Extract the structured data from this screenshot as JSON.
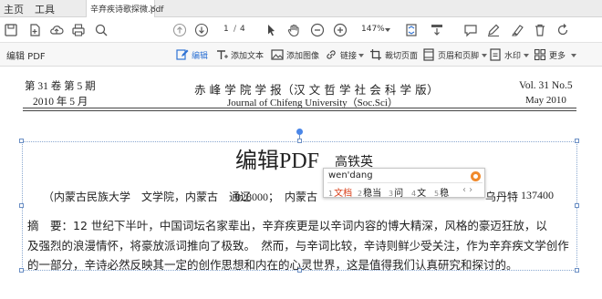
{
  "tabbar": {
    "home": "主页",
    "tools": "工具",
    "doc_tab": "辛弃疾诗歌探微.pdf",
    "close": "×"
  },
  "toolbar": {
    "page_current": "1",
    "page_separator": "/",
    "page_total": "4",
    "zoom": "147%"
  },
  "ribbon": {
    "title": "编辑 PDF",
    "items": [
      {
        "label": "编辑",
        "icon": "edit-icon"
      },
      {
        "label": "添加文本",
        "icon": "add-text-icon"
      },
      {
        "label": "添加图像",
        "icon": "add-image-icon"
      },
      {
        "label": "链接",
        "icon": "link-icon"
      },
      {
        "label": "裁切页面",
        "icon": "crop-icon"
      },
      {
        "label": "页眉和页脚",
        "icon": "header-footer-icon"
      },
      {
        "label": "水印",
        "icon": "watermark-icon"
      },
      {
        "label": "更多",
        "icon": "more-icon"
      }
    ]
  },
  "document": {
    "header_left_1": "第 31 卷 第 5 期",
    "header_left_2": "2010 年 5 月",
    "header_center_cn": "赤 峰 学 院 学 报（汉 文 哲 学 社 会 科 学 版）",
    "header_center_en": "Journal of Chifeng University（Soc.Sci）",
    "header_right_1": "Vol. 31 No.5",
    "header_right_2": "May  2010",
    "title": "编辑PDF",
    "author": "高铁英",
    "affiliation": "（内蒙古民族大学　文学院，内蒙古　通辽",
    "zip": "028000；",
    "affiliation_2": "内蒙古",
    "affiliation_right_1": "乌丹特",
    "affiliation_right_2": "137400",
    "abstract_lines": [
      "摘　要：12 世纪下半叶，中国词坛名家辈出，辛弃疾更是以辛词内容的博大精深，风格的豪迈狂放，以",
      "及强烈的浪漫情怀，将豪放派词推向了极致。　然而，与辛词比较，辛诗则鲜少受关注，作为辛弃疾文学创作",
      "的一部分，辛诗必然反映其一定的创作思想和内在的心灵世界，这是值得我们认真研究和探讨的。"
    ]
  },
  "ime": {
    "composition": "wen'dang",
    "candidates": [
      {
        "num": "1",
        "text": "文档"
      },
      {
        "num": "2",
        "text": "稳当"
      },
      {
        "num": "3",
        "text": "问"
      },
      {
        "num": "4",
        "text": "文"
      },
      {
        "num": "5",
        "text": "稳"
      }
    ],
    "nav": "‹ ›"
  },
  "colors": {
    "accent": "#2f73d4",
    "selection_frame": "#8aa8d0",
    "ime_selected": "#d9401a"
  }
}
